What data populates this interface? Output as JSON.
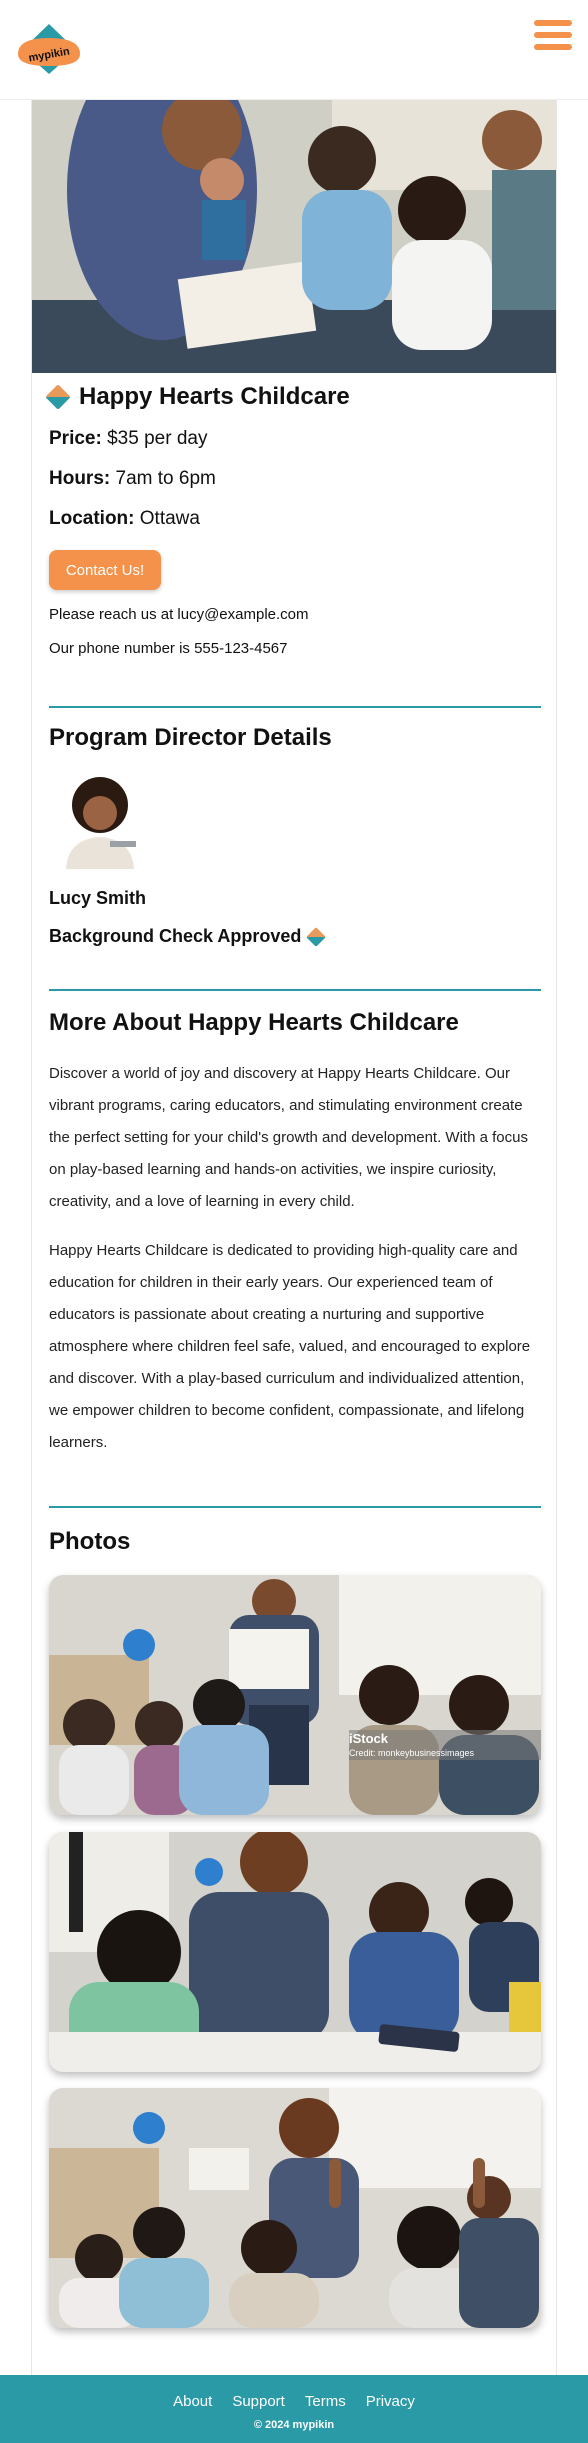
{
  "header": {
    "logo_text": "mypikin",
    "menu_icon": "hamburger-menu-icon"
  },
  "listing": {
    "title": "Happy Hearts Childcare",
    "price_label": "Price:",
    "price_value": "$35 per day",
    "hours_label": "Hours:",
    "hours_value": "7am to 6pm",
    "location_label": "Location:",
    "location_value": "Ottawa",
    "contact_button": "Contact Us!",
    "email_line": "Please reach us at lucy@example.com",
    "phone_line": "Our phone number is 555-123-4567"
  },
  "director": {
    "heading": "Program Director Details",
    "name": "Lucy Smith",
    "background_check": "Background Check Approved"
  },
  "about": {
    "heading": "More About Happy Hearts Childcare",
    "paragraph1": "Discover a world of joy and discovery at Happy Hearts Childcare. Our vibrant programs, caring educators, and stimulating environment create the perfect setting for your child's growth and development. With a focus on play-based learning and hands-on activities, we inspire curiosity, creativity, and a love of learning in every child.",
    "paragraph2": "Happy Hearts Childcare is dedicated to providing high-quality care and education for children in their early years. Our experienced team of educators is passionate about creating a nurturing and supportive atmosphere where children feel safe, valued, and encouraged to explore and discover. With a play-based curriculum and individualized attention, we empower children to become confident, compassionate, and lifelong learners."
  },
  "photos": {
    "heading": "Photos",
    "watermark_brand": "iStock",
    "watermark_credit": "Credit: monkeybusinessimages"
  },
  "footer": {
    "links": [
      "About",
      "Support",
      "Terms",
      "Privacy"
    ],
    "copyright": "© 2024 mypikin"
  },
  "colors": {
    "accent_orange": "#f4914a",
    "accent_teal": "#2a9aa6"
  }
}
